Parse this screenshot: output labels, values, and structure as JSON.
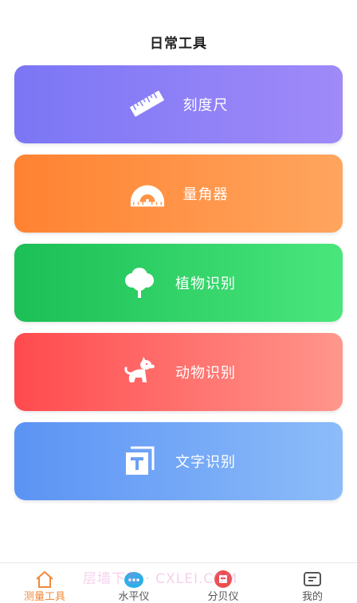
{
  "header": {
    "title": "日常工具"
  },
  "tools": [
    {
      "label": "刻度尺",
      "icon": "ruler-icon"
    },
    {
      "label": "量角器",
      "icon": "protractor-icon"
    },
    {
      "label": "植物识别",
      "icon": "tree-icon"
    },
    {
      "label": "动物识别",
      "icon": "dog-icon"
    },
    {
      "label": "文字识别",
      "icon": "text-scan-icon"
    }
  ],
  "tabbar": {
    "active": 0,
    "tabs": [
      {
        "label": "测量工具",
        "icon": "home-icon"
      },
      {
        "label": "水平仪",
        "icon": "level-icon"
      },
      {
        "label": "分贝仪",
        "icon": "decibel-icon"
      },
      {
        "label": "我的",
        "icon": "profile-icon"
      }
    ]
  },
  "watermark": "层墙下载 · CXLEI.COM",
  "colors": {
    "accent": "#f08a3c",
    "card_ruler": "#7b76f5",
    "card_protractor": "#ff8231",
    "card_plant": "#1bbf55",
    "card_animal": "#ff4a4e",
    "card_text": "#5b93f4"
  }
}
